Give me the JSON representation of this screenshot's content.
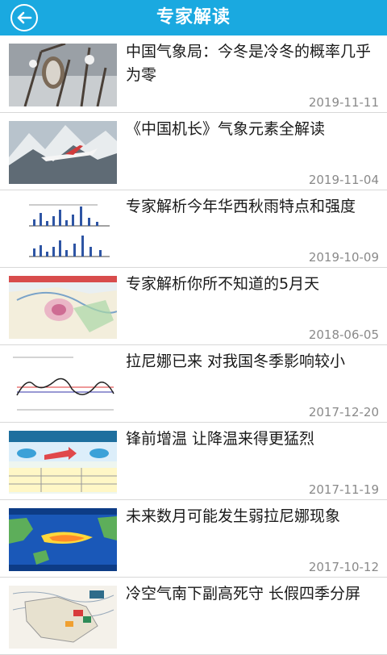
{
  "header": {
    "title": "专家解读"
  },
  "articles": [
    {
      "title": "中国气象局：今冬是冷冬的概率几乎为零",
      "date": "2019-11-11",
      "image": "frost-branch"
    },
    {
      "title": "《中国机长》气象元素全解读",
      "date": "2019-11-04",
      "image": "airplane-mountains"
    },
    {
      "title": "专家解析今年华西秋雨特点和强度",
      "date": "2019-10-09",
      "image": "bar-charts"
    },
    {
      "title": "专家解析你所不知道的5月天",
      "date": "2018-06-05",
      "image": "weather-map"
    },
    {
      "title": "拉尼娜已来 对我国冬季影响较小",
      "date": "2017-12-20",
      "image": "line-chart"
    },
    {
      "title": "锋前增温  让降温来得更猛烈",
      "date": "2017-11-19",
      "image": "cold-air-diagram"
    },
    {
      "title": "未来数月可能发生弱拉尼娜现象",
      "date": "2017-10-12",
      "image": "ocean-map"
    },
    {
      "title": "冷空气南下副高死守 长假四季分屏",
      "date": "",
      "image": "precip-map"
    }
  ]
}
